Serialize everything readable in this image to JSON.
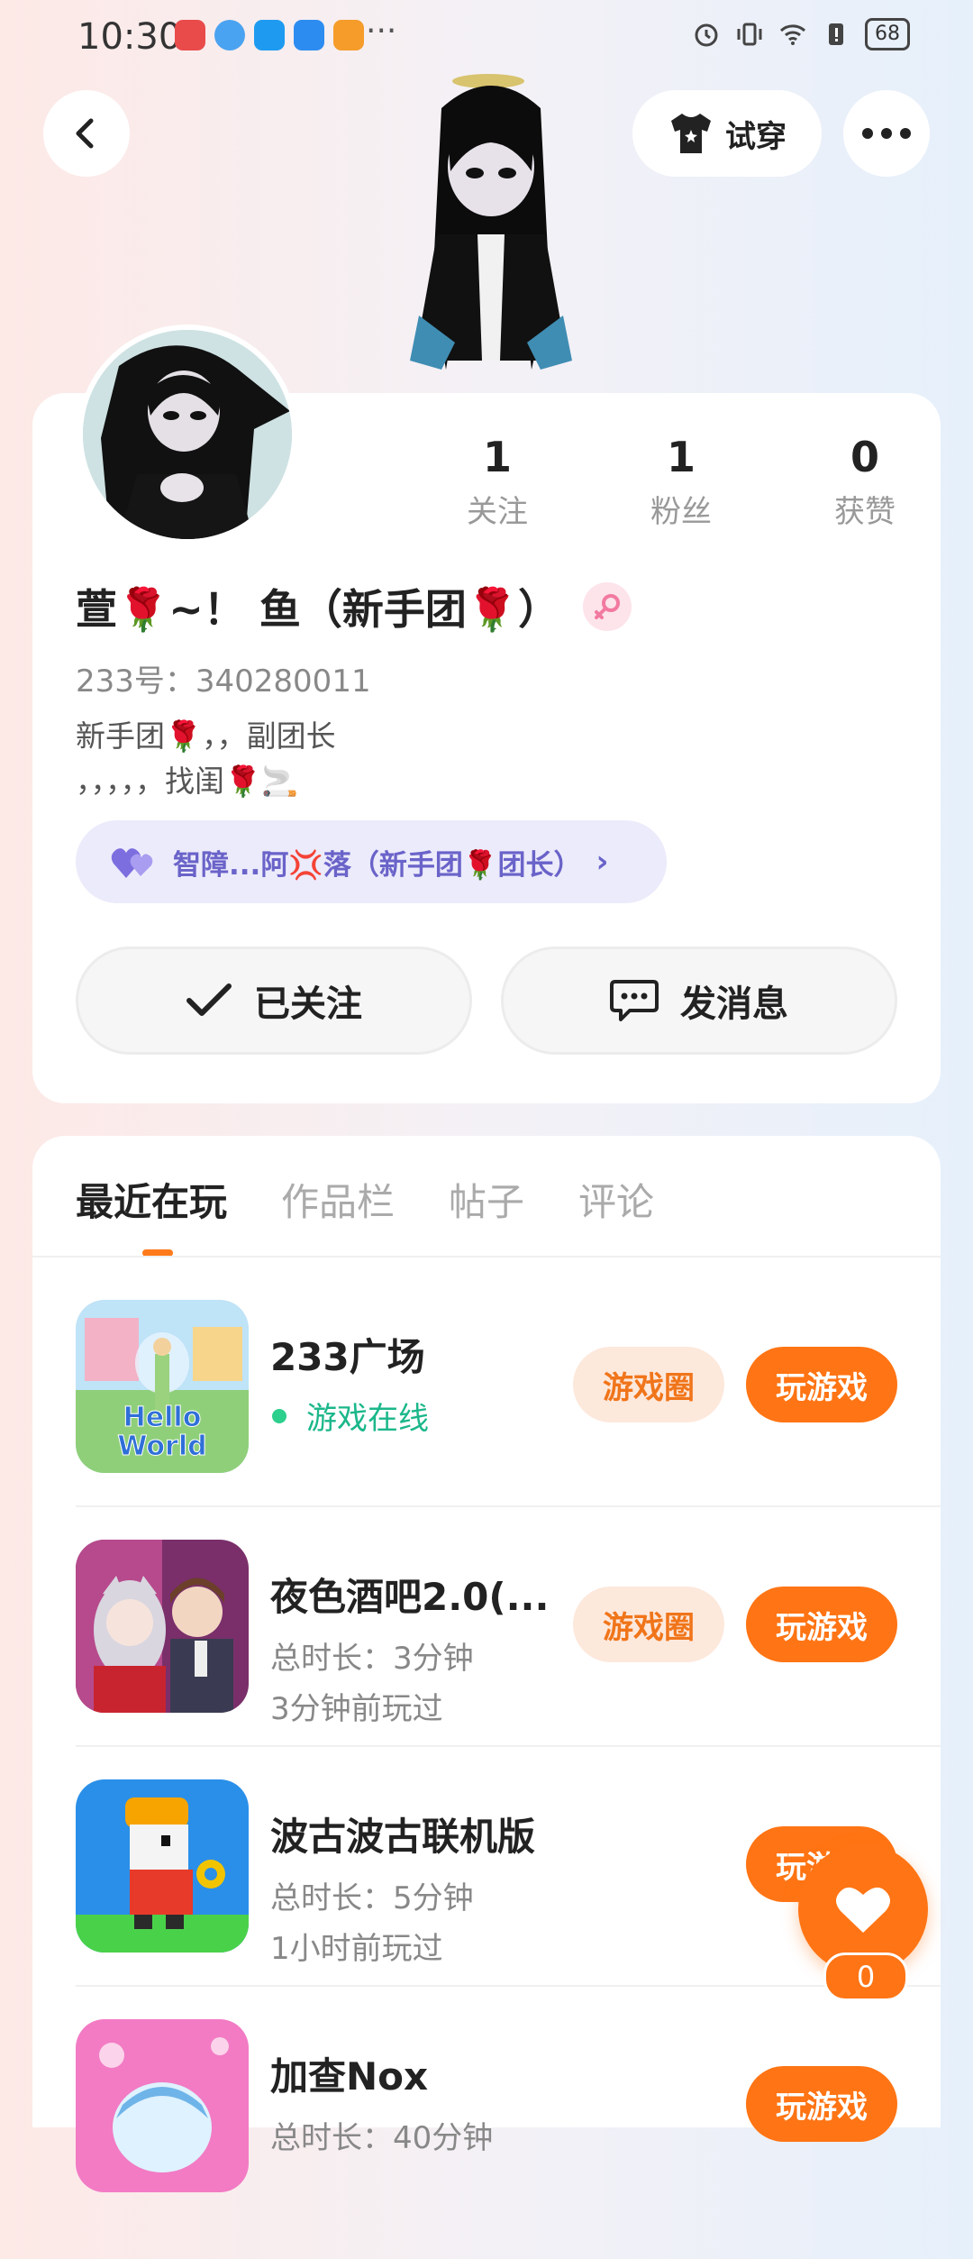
{
  "status_bar": {
    "time": "10:30",
    "more": "···",
    "battery": "68",
    "app_icon_colors": [
      "#e94b4b",
      "#4aa3f0",
      "#1e9bf0",
      "#2d8cf0",
      "#f59c2a"
    ]
  },
  "header": {
    "tryon_label": "试穿"
  },
  "profile": {
    "stats": [
      {
        "value": "1",
        "label": "关注"
      },
      {
        "value": "1",
        "label": "粉丝"
      },
      {
        "value": "0",
        "label": "获赞"
      }
    ],
    "name": "萱🌹~！ 鱼（新手团🌹）",
    "uid": "233号：340280011",
    "bio": [
      "新手团🌹，，副团长",
      "，，，，，找闺🌹🚬"
    ],
    "relation": "智障...阿💢落（新手团🌹团长）",
    "follow_label": "已关注",
    "message_label": "发消息"
  },
  "tabs": [
    "最近在玩",
    "作品栏",
    "帖子",
    "评论"
  ],
  "games": [
    {
      "title": "233广场",
      "line1": "游戏在线",
      "line2": "",
      "circle": "游戏圈",
      "play": "玩游戏"
    },
    {
      "title": "夜色酒吧2.0(...",
      "line1": "总时长：3分钟",
      "line2": "3分钟前玩过",
      "circle": "游戏圈",
      "play": "玩游戏"
    },
    {
      "title": "波古波古联机版",
      "line1": "总时长：5分钟",
      "line2": "1小时前玩过",
      "circle": "",
      "play": "玩游戏"
    },
    {
      "title": "加查Nox",
      "line1": "总时长：40分钟",
      "line2": "",
      "circle": "",
      "play": "玩游戏"
    }
  ],
  "like_count": "0",
  "colors": {
    "accent": "#ff7414",
    "accent_light": "#fde8dc",
    "online": "#1bb78a",
    "relation_bg": "#ecebfb",
    "relation_text": "#6a63c9"
  }
}
